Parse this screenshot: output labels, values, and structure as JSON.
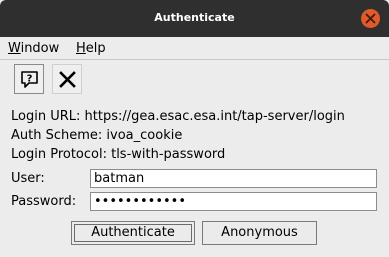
{
  "window": {
    "title": "Authenticate"
  },
  "menu": {
    "items": [
      {
        "label": "Window",
        "mnemonic": "W"
      },
      {
        "label": "Help",
        "mnemonic": "H"
      }
    ]
  },
  "toolbar": {
    "buttons": [
      {
        "name": "help",
        "icon": "help-question-icon"
      },
      {
        "name": "cancel",
        "icon": "close-x-icon"
      }
    ]
  },
  "info": {
    "login_url": "Login URL: https://gea.esac.esa.int/tap-server/login",
    "auth_scheme": "Auth Scheme: ivoa_cookie",
    "login_protocol": "Login Protocol: tls-with-password"
  },
  "form": {
    "user_label": "User:",
    "user_value": "batman",
    "password_label": "Password:",
    "password_masked": "••••••••••••"
  },
  "actions": {
    "authenticate_label": "Authenticate",
    "anonymous_label": "Anonymous"
  },
  "colors": {
    "titlebar": "#2f2f2f",
    "close": "#e05a2b",
    "background": "#ececec"
  }
}
